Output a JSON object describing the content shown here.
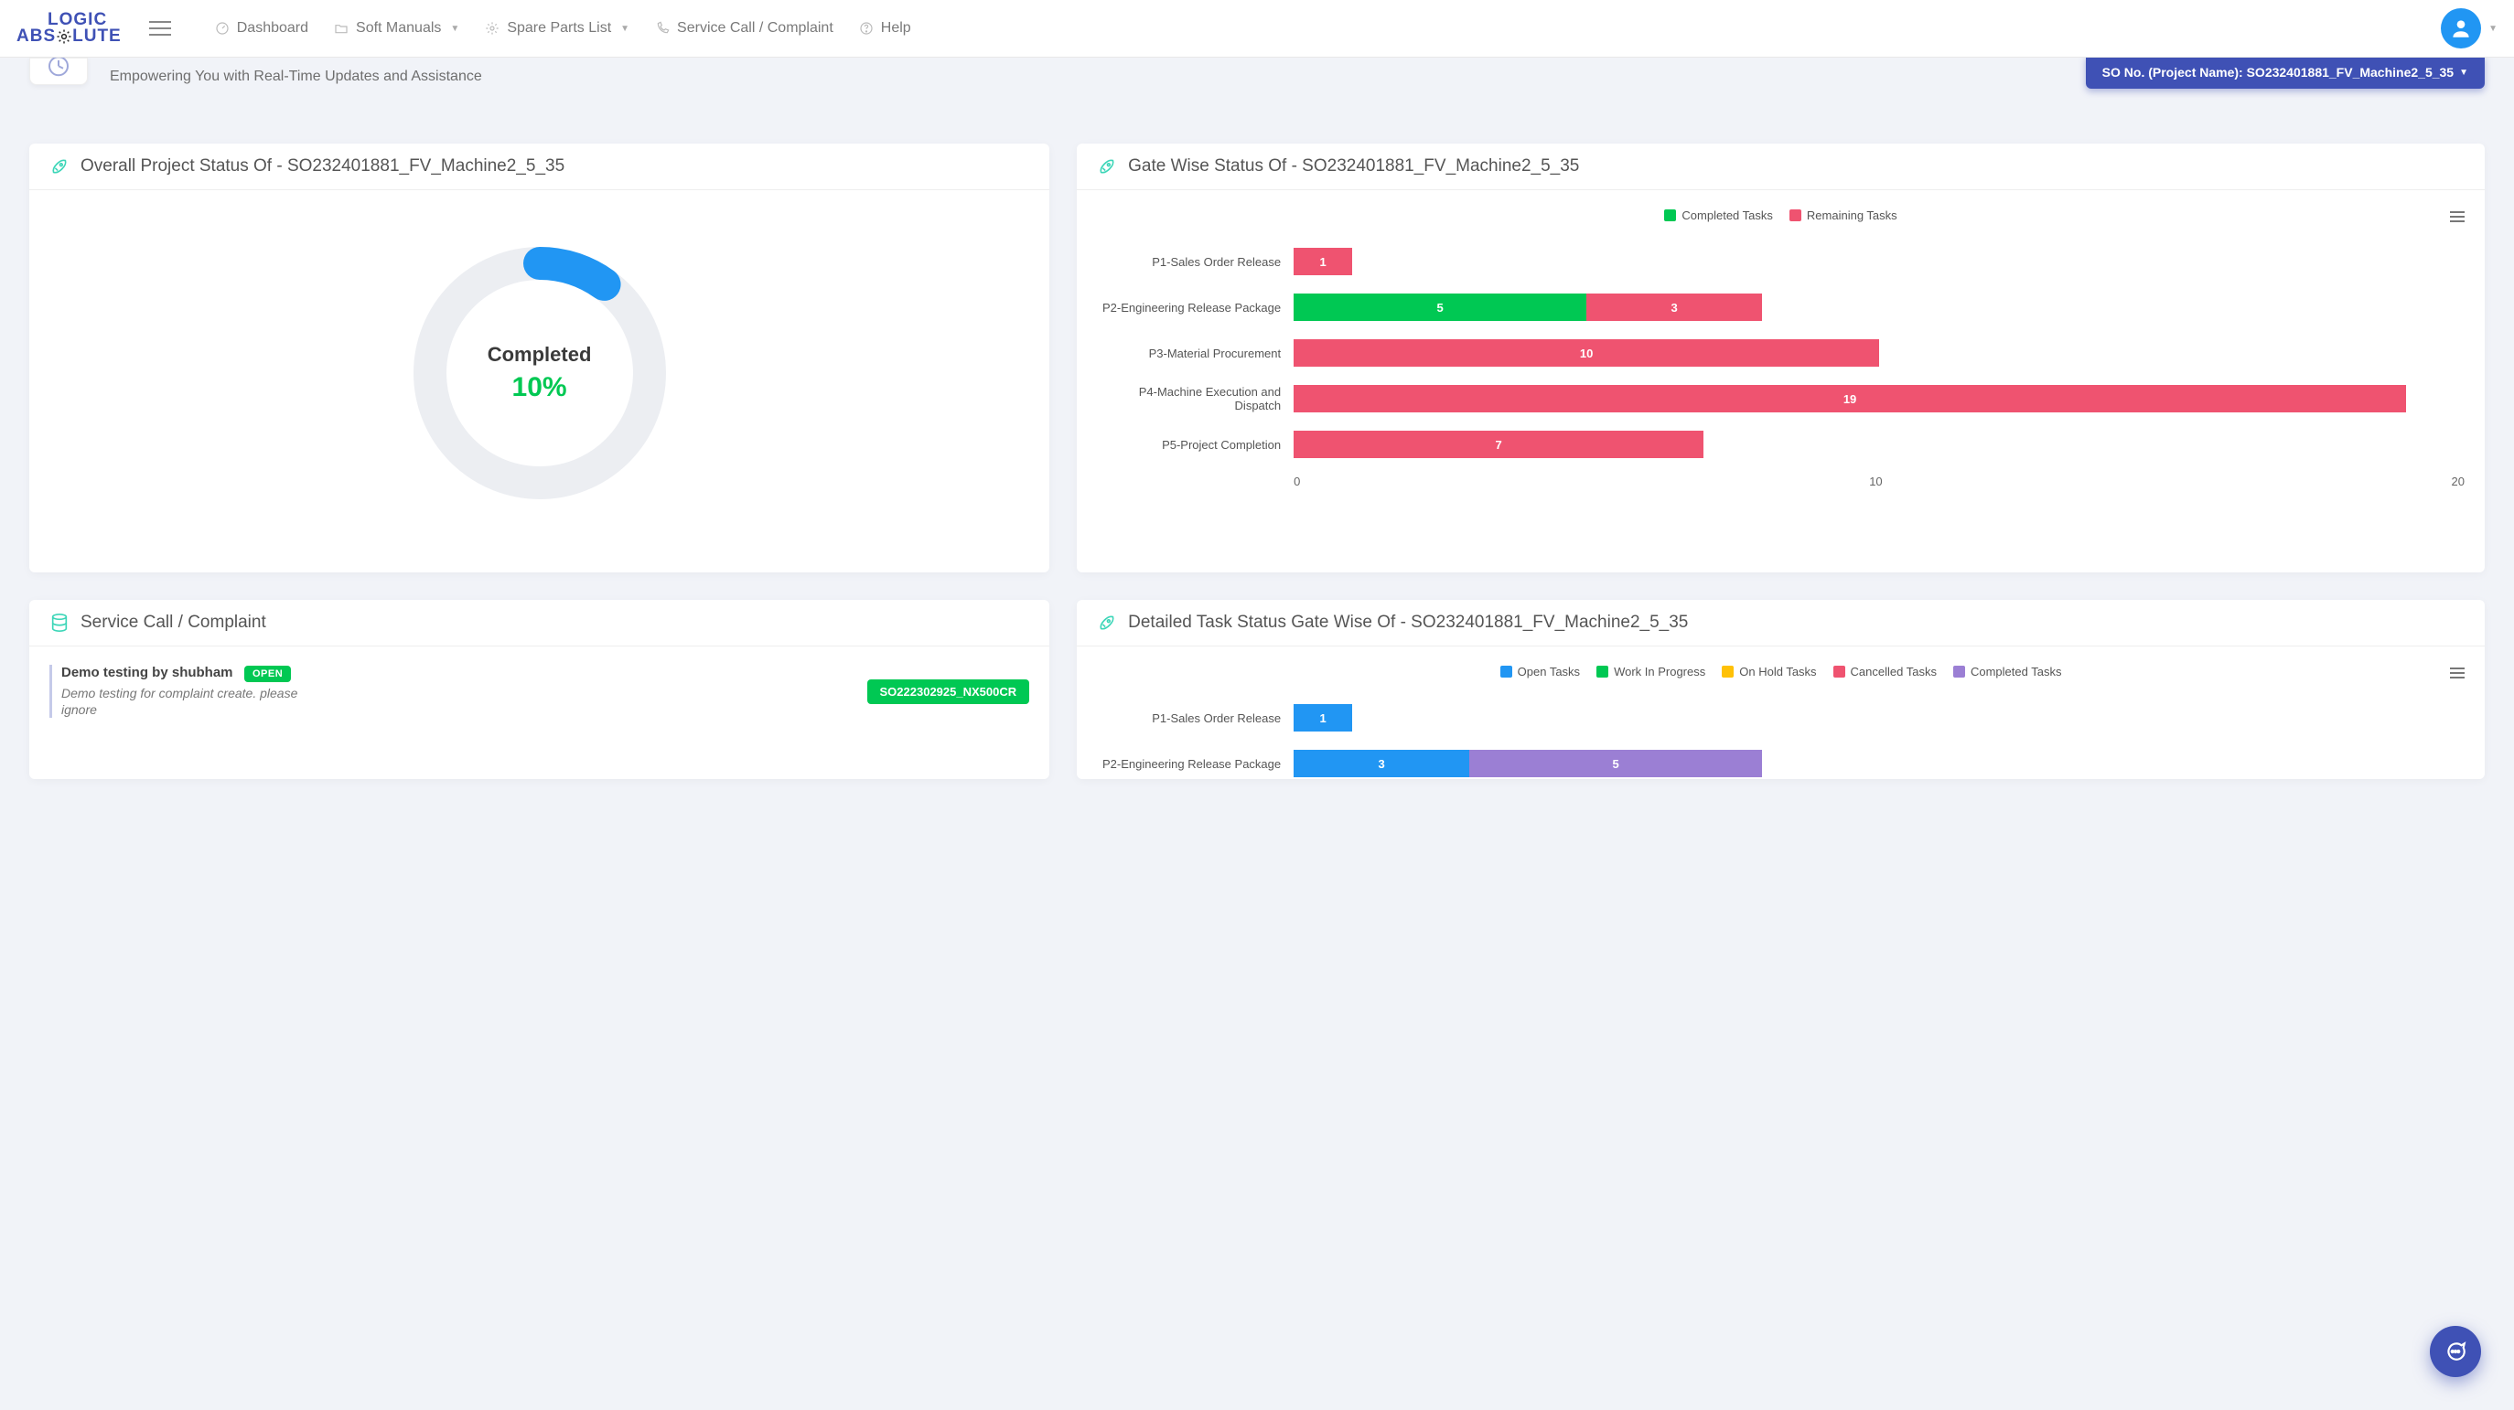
{
  "colors": {
    "brand": "#3f51b5",
    "green": "#00c853",
    "red": "#ef5370",
    "blue": "#2196f3",
    "purple": "#9b7fd4",
    "orange": "#ffc107"
  },
  "header": {
    "logo_top": "LOGIC",
    "logo_bottom_pre": "ABS",
    "logo_bottom_post": "LUTE",
    "nav": {
      "dashboard": "Dashboard",
      "soft_manuals": "Soft Manuals",
      "spare_parts": "Spare Parts List",
      "service_call": "Service Call / Complaint",
      "help": "Help"
    }
  },
  "banner": {
    "subtitle": "Empowering You with Real-Time Updates and Assistance",
    "so_label": "SO No. (Project Name): SO232401881_FV_Machine2_5_35"
  },
  "overall": {
    "title": "Overall Project Status Of - SO232401881_FV_Machine2_5_35",
    "center_label": "Completed",
    "percent_text": "10%",
    "percent_value": 10
  },
  "gatewise": {
    "title": "Gate Wise Status Of - SO232401881_FV_Machine2_5_35",
    "legend_completed": "Completed Tasks",
    "legend_remaining": "Remaining Tasks",
    "xmax": 20,
    "ticks": [
      "0",
      "10",
      "20"
    ]
  },
  "service": {
    "title": "Service Call / Complaint",
    "item_title": "Demo testing by shubham",
    "item_status": "OPEN",
    "item_desc": "Demo testing for complaint create. please ignore",
    "item_so": "SO222302925_NX500CR"
  },
  "detailed": {
    "title": "Detailed Task Status Gate Wise Of - SO232401881_FV_Machine2_5_35",
    "legend": {
      "open": "Open Tasks",
      "wip": "Work In Progress",
      "hold": "On Hold Tasks",
      "cancelled": "Cancelled Tasks",
      "completed": "Completed Tasks"
    }
  },
  "chart_data": [
    {
      "type": "bar",
      "orientation": "horizontal",
      "stacked": true,
      "title": "Gate Wise Status",
      "categories": [
        "P1-Sales Order Release",
        "P2-Engineering Release Package",
        "P3-Material Procurement",
        "P4-Machine Execution and Dispatch",
        "P5-Project Completion"
      ],
      "series": [
        {
          "name": "Completed Tasks",
          "color": "#00c853",
          "values": [
            0,
            5,
            0,
            0,
            0
          ]
        },
        {
          "name": "Remaining Tasks",
          "color": "#ef5370",
          "values": [
            1,
            3,
            10,
            19,
            7
          ]
        }
      ],
      "xlabel": "",
      "ylabel": "",
      "xlim": [
        0,
        20
      ]
    },
    {
      "type": "bar",
      "orientation": "horizontal",
      "stacked": true,
      "title": "Detailed Task Status Gate Wise",
      "categories": [
        "P1-Sales Order Release",
        "P2-Engineering Release Package"
      ],
      "series": [
        {
          "name": "Open Tasks",
          "color": "#2196f3",
          "values": [
            1,
            3
          ]
        },
        {
          "name": "Work In Progress",
          "color": "#00c853",
          "values": [
            0,
            0
          ]
        },
        {
          "name": "On Hold Tasks",
          "color": "#ffc107",
          "values": [
            0,
            0
          ]
        },
        {
          "name": "Cancelled Tasks",
          "color": "#ef5370",
          "values": [
            0,
            0
          ]
        },
        {
          "name": "Completed Tasks",
          "color": "#9b7fd4",
          "values": [
            0,
            5
          ]
        }
      ],
      "xlabel": "",
      "ylabel": "",
      "xlim": [
        0,
        20
      ]
    },
    {
      "type": "pie",
      "title": "Overall Project Status",
      "series": [
        {
          "name": "Completed",
          "value": 10,
          "color": "#2196f3"
        },
        {
          "name": "Remaining",
          "value": 90,
          "color": "#eceef2"
        }
      ]
    }
  ]
}
